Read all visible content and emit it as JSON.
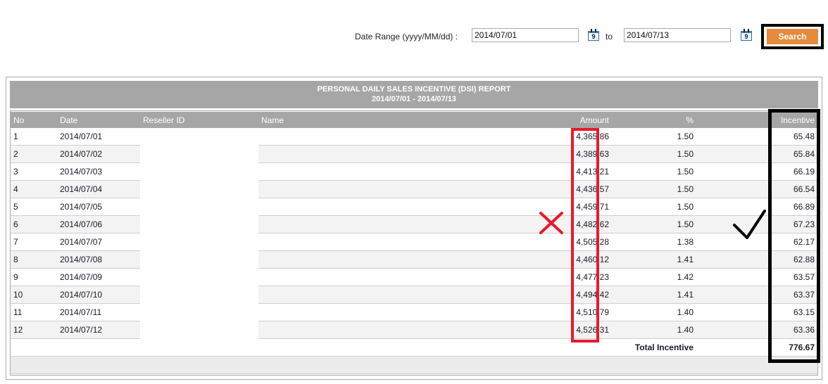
{
  "filter": {
    "label": "Date Range (yyyy/MM/dd) :",
    "from_value": "2014/07/01",
    "to_label": "to",
    "to_value": "2014/07/13",
    "calendar_icon_glyph": "9",
    "search_label": "Search"
  },
  "report": {
    "title": "PERSONAL DAILY SALES INCENTIVE (DSI) REPORT",
    "subtitle": "2014/07/01 - 2014/07/13",
    "columns": {
      "no": "No",
      "date": "Date",
      "reseller_id": "Reseller ID",
      "name": "Name",
      "amount": "Amount",
      "percent": "%",
      "incentive": "Incentive"
    },
    "rows": [
      {
        "no": "1",
        "date": "2014/07/01",
        "amount": "4,365.86",
        "percent": "1.50",
        "incentive": "65.48"
      },
      {
        "no": "2",
        "date": "2014/07/02",
        "amount": "4,389.63",
        "percent": "1.50",
        "incentive": "65.84"
      },
      {
        "no": "3",
        "date": "2014/07/03",
        "amount": "4,413.21",
        "percent": "1.50",
        "incentive": "66.19"
      },
      {
        "no": "4",
        "date": "2014/07/04",
        "amount": "4,436.57",
        "percent": "1.50",
        "incentive": "66.54"
      },
      {
        "no": "5",
        "date": "2014/07/05",
        "amount": "4,459.71",
        "percent": "1.50",
        "incentive": "66.89"
      },
      {
        "no": "6",
        "date": "2014/07/06",
        "amount": "4,482.62",
        "percent": "1.50",
        "incentive": "67.23"
      },
      {
        "no": "7",
        "date": "2014/07/07",
        "amount": "4,505.28",
        "percent": "1.38",
        "incentive": "62.17"
      },
      {
        "no": "8",
        "date": "2014/07/08",
        "amount": "4,460.12",
        "percent": "1.41",
        "incentive": "62.88"
      },
      {
        "no": "9",
        "date": "2014/07/09",
        "amount": "4,477.23",
        "percent": "1.42",
        "incentive": "63.57"
      },
      {
        "no": "10",
        "date": "2014/07/10",
        "amount": "4,494.42",
        "percent": "1.41",
        "incentive": "63.37"
      },
      {
        "no": "11",
        "date": "2014/07/11",
        "amount": "4,510.79",
        "percent": "1.40",
        "incentive": "63.15"
      },
      {
        "no": "12",
        "date": "2014/07/12",
        "amount": "4,526.31",
        "percent": "1.40",
        "incentive": "63.36"
      }
    ],
    "total_label": "Total Incentive",
    "total_value": "776.67"
  },
  "annotations": {
    "amount_box_color": "#e8192c",
    "incentive_box_color": "#000000",
    "cross_color": "#e8192c",
    "check_color": "#000000"
  }
}
